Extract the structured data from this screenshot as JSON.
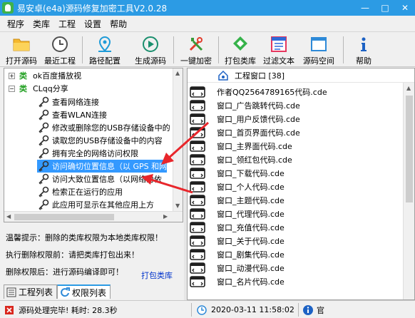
{
  "window": {
    "title": "易安卓(e4a)源码修复加密工具V2.0.28",
    "minimize": "—",
    "maximize": "□",
    "close": "✕"
  },
  "menu": [
    "程序",
    "类库",
    "工程",
    "设置",
    "帮助"
  ],
  "toolbar": [
    {
      "label": "打开源码",
      "icon": "folder-icon"
    },
    {
      "label": "最近工程",
      "icon": "clock-icon"
    },
    {
      "label": "路径配置",
      "icon": "location-pin-icon"
    },
    {
      "label": "生成源码",
      "icon": "play-icon"
    },
    {
      "label": "一键加密",
      "icon": "tools-icon"
    },
    {
      "label": "打包类库",
      "icon": "package-icon"
    },
    {
      "label": "过滤文本",
      "icon": "filter-text-icon"
    },
    {
      "label": "源码空间",
      "icon": "window-icon"
    },
    {
      "label": "帮助",
      "icon": "info-icon"
    }
  ],
  "tree": {
    "category_marker": "类",
    "categories": [
      {
        "name": "ok百度播放视",
        "expander": "+"
      },
      {
        "name": "CLqq分享",
        "expander": "−"
      }
    ],
    "permissions": [
      "查看网络连接",
      "查看WLAN连接",
      "修改或删除您的USB存储设备中的",
      "读取您的USB存储设备中的内容",
      "拥有完全的网络访问权限",
      "访问确切位置信息（以 GPS 和网",
      "访问大致位置信息（以网络为依",
      "检索正在运行的应用",
      "此应用可显示在其他应用上方"
    ],
    "selected_index": 5
  },
  "info": {
    "tip": "温馨提示：删除的类库权限为本地类库权限！",
    "step1": "执行删除权限前：请把类库打包出来！",
    "step2": "删除权限后：进行源码编译即可！",
    "pack_link": "打包类库"
  },
  "tabs": [
    {
      "label": "工程列表",
      "active": false
    },
    {
      "label": "权限列表",
      "active": true
    }
  ],
  "project_list": {
    "header": "工程窗口 [38]",
    "files": [
      "作者QQ2564789165代码.cde",
      "窗口_广告跳转代码.cde",
      "窗口_用户反馈代码.cde",
      "窗口_首页界面代码.cde",
      "窗口_主界面代码.cde",
      "窗口_领红包代码.cde",
      "窗口_下载代码.cde",
      "窗口_个人代码.cde",
      "窗口_主题代码.cde",
      "窗口_代理代码.cde",
      "窗口_充值代码.cde",
      "窗口_关于代码.cde",
      "窗口_剧集代码.cde",
      "窗口_动漫代码.cde",
      "窗口_名片代码.cde"
    ]
  },
  "status": {
    "message": "源码处理完毕! 耗时: 28.3秒",
    "datetime": "2020-03-11  11:58:02",
    "extra": "官"
  },
  "colors": {
    "titlebar": "#2c9be4",
    "selection": "#3399ff",
    "category_green": "#22a022",
    "arrow_red": "#e8262b",
    "link_blue": "#0033cc"
  }
}
